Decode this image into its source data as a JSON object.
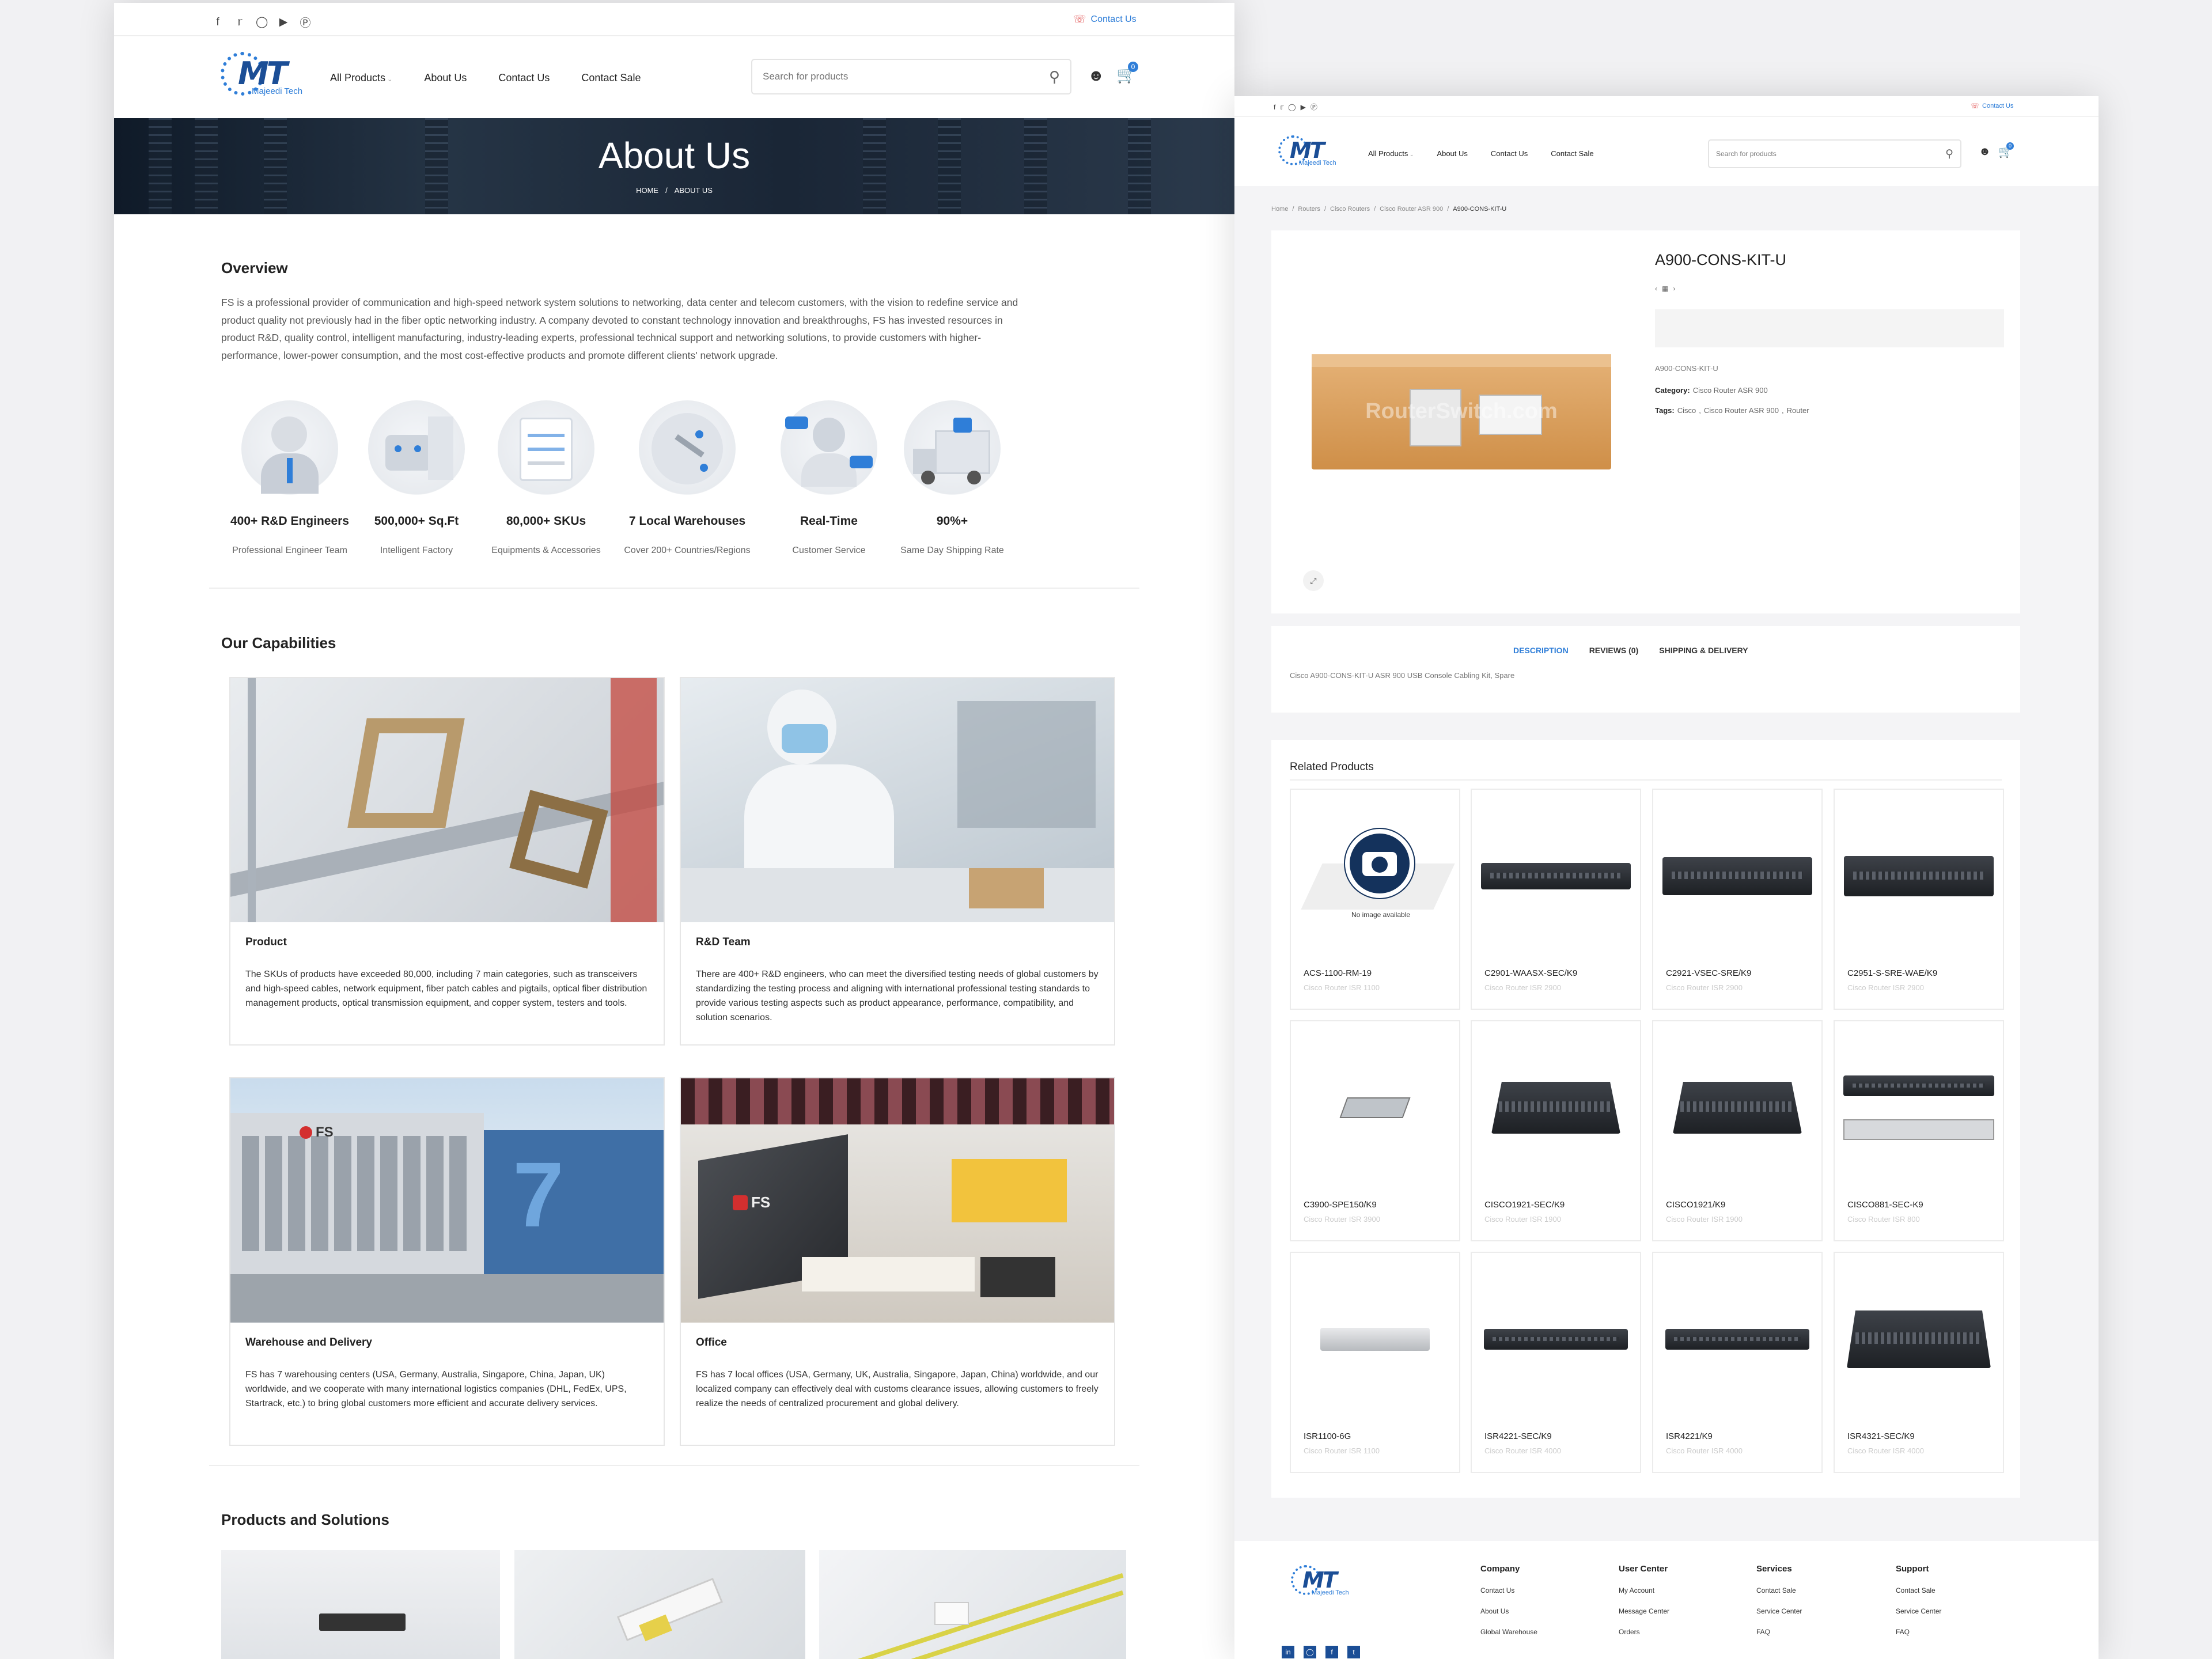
{
  "colors": {
    "accent": "#2f7ed8",
    "brand": "#1b4e96",
    "text": "#222222",
    "muted": "#999999"
  },
  "header": {
    "social_icons": [
      "facebook-icon",
      "twitter-icon",
      "instagram-icon",
      "youtube-icon",
      "pinterest-icon"
    ],
    "contact_link": "Contact Us",
    "logo_mark": "MT",
    "logo_name": "Majeedi Tech",
    "nav": [
      "All Products",
      "About Us",
      "Contact Us",
      "Contact Sale"
    ],
    "search_placeholder": "Search for products",
    "cart_count": "0"
  },
  "about_page": {
    "hero_title": "About Us",
    "breadcrumb": [
      "HOME",
      "ABOUT US"
    ],
    "overview_heading": "Overview",
    "overview_text": "FS is a professional provider of communication and high-speed network system solutions to networking, data center and telecom customers, with the vision to redefine service and product quality not previously had in the fiber optic networking industry. A company devoted to constant technology innovation and breakthroughs, FS has invested resources in product R&D, quality control, intelligent manufacturing, industry-leading experts, professional technical support and networking solutions, to provide customers with higher-performance, lower-power consumption, and the most cost-effective products and promote different clients' network upgrade.",
    "stats": [
      {
        "value": "400+ R&D Engineers",
        "label": "Professional Engineer Team",
        "icon": "engineers-icon"
      },
      {
        "value": "500,000+ Sq.Ft",
        "label": "Intelligent Factory",
        "icon": "factory-robot-icon"
      },
      {
        "value": "80,000+ SKUs",
        "label": "Equipments & Accessories",
        "icon": "checklist-icon"
      },
      {
        "value": "7 Local Warehouses",
        "label": "Cover 200+ Countries/Regions",
        "icon": "globe-plane-icon"
      },
      {
        "value": "Real-Time",
        "label": "Customer Service",
        "icon": "support-agent-icon"
      },
      {
        "value": "90%+",
        "label": "Same Day Shipping Rate",
        "icon": "delivery-truck-icon"
      }
    ],
    "capabilities_heading": "Our Capabilities",
    "capabilities": [
      {
        "title": "Product",
        "text": "The SKUs of products have exceeded 80,000, including 7 main categories, such as transceivers and high-speed cables, network equipment, fiber patch cables and pigtails, optical fiber distribution management products, optical transmission equipment, and copper system, testers and tools."
      },
      {
        "title": "R&D Team",
        "text": "There are 400+ R&D engineers, who can meet the diversified testing needs of global customers by standardizing the testing process and aligning with international professional testing standards to provide various testing aspects such as product appearance, performance, compatibility, and solution scenarios."
      },
      {
        "title": "Warehouse and Delivery",
        "text": "FS has 7 warehousing centers (USA, Germany, Australia, Singapore, China, Japan, UK) worldwide, and we cooperate with many international logistics companies (DHL, FedEx, UPS, Startrack, etc.) to bring global customers more efficient and accurate delivery services."
      },
      {
        "title": "Office",
        "text": "FS has 7 local offices (USA, Germany, UK, Australia, Singapore, Japan, China) worldwide, and our localized company can effectively deal with customs clearance issues, allowing customers to freely realize the needs of centralized procurement and global delivery."
      }
    ],
    "image_signs": {
      "fs_logo": "FS",
      "building_number": "7"
    },
    "products_heading": "Products and Solutions"
  },
  "product_page": {
    "breadcrumb": [
      "Home",
      "Routers",
      "Cisco Routers",
      "Cisco Router ASR 900",
      "A900-CONS-KIT-U"
    ],
    "product_title": "A900-CONS-KIT-U",
    "sku": "A900-CONS-KIT-U",
    "category_label": "Category:",
    "category_value": "Cisco Router ASR 900",
    "tags_label": "Tags:",
    "tags": [
      "Cisco",
      "Cisco Router ASR 900",
      "Router"
    ],
    "watermark": "RouterSwitch.com",
    "tabs": [
      "DESCRIPTION",
      "REVIEWS (0)",
      "SHIPPING & DELIVERY"
    ],
    "description": "Cisco A900-CONS-KIT-U ASR 900 USB Console Cabling Kit, Spare",
    "related_heading": "Related Products",
    "no_image_text": "No image available",
    "related": [
      {
        "name": "ACS-1100-RM-19",
        "category": "Cisco Router ISR 1100"
      },
      {
        "name": "C2901-WAASX-SEC/K9",
        "category": "Cisco Router ISR 2900"
      },
      {
        "name": "C2921-VSEC-SRE/K9",
        "category": "Cisco Router ISR 2900"
      },
      {
        "name": "C2951-S-SRE-WAE/K9",
        "category": "Cisco Router ISR 2900"
      },
      {
        "name": "C3900-SPE150/K9",
        "category": "Cisco Router ISR 3900"
      },
      {
        "name": "CISCO1921-SEC/K9",
        "category": "Cisco Router ISR 1900"
      },
      {
        "name": "CISCO1921/K9",
        "category": "Cisco Router ISR 1900"
      },
      {
        "name": "CISCO881-SEC-K9",
        "category": "Cisco Router ISR 800"
      },
      {
        "name": "ISR1100-6G",
        "category": "Cisco Router ISR 1100"
      },
      {
        "name": "ISR4221-SEC/K9",
        "category": "Cisco Router ISR 4000"
      },
      {
        "name": "ISR4221/K9",
        "category": "Cisco Router ISR 4000"
      },
      {
        "name": "ISR4321-SEC/K9",
        "category": "Cisco Router ISR 4000"
      }
    ],
    "footer": {
      "columns": [
        {
          "heading": "Company",
          "links": [
            "Contact Us",
            "About Us",
            "Global Warehouse"
          ]
        },
        {
          "heading": "User Center",
          "links": [
            "My Account",
            "Message Center",
            "Orders"
          ]
        },
        {
          "heading": "Services",
          "links": [
            "Contact Sale",
            "Service Center",
            "FAQ"
          ]
        },
        {
          "heading": "Support",
          "links": [
            "Contact Sale",
            "Service Center",
            "FAQ"
          ]
        }
      ]
    }
  }
}
